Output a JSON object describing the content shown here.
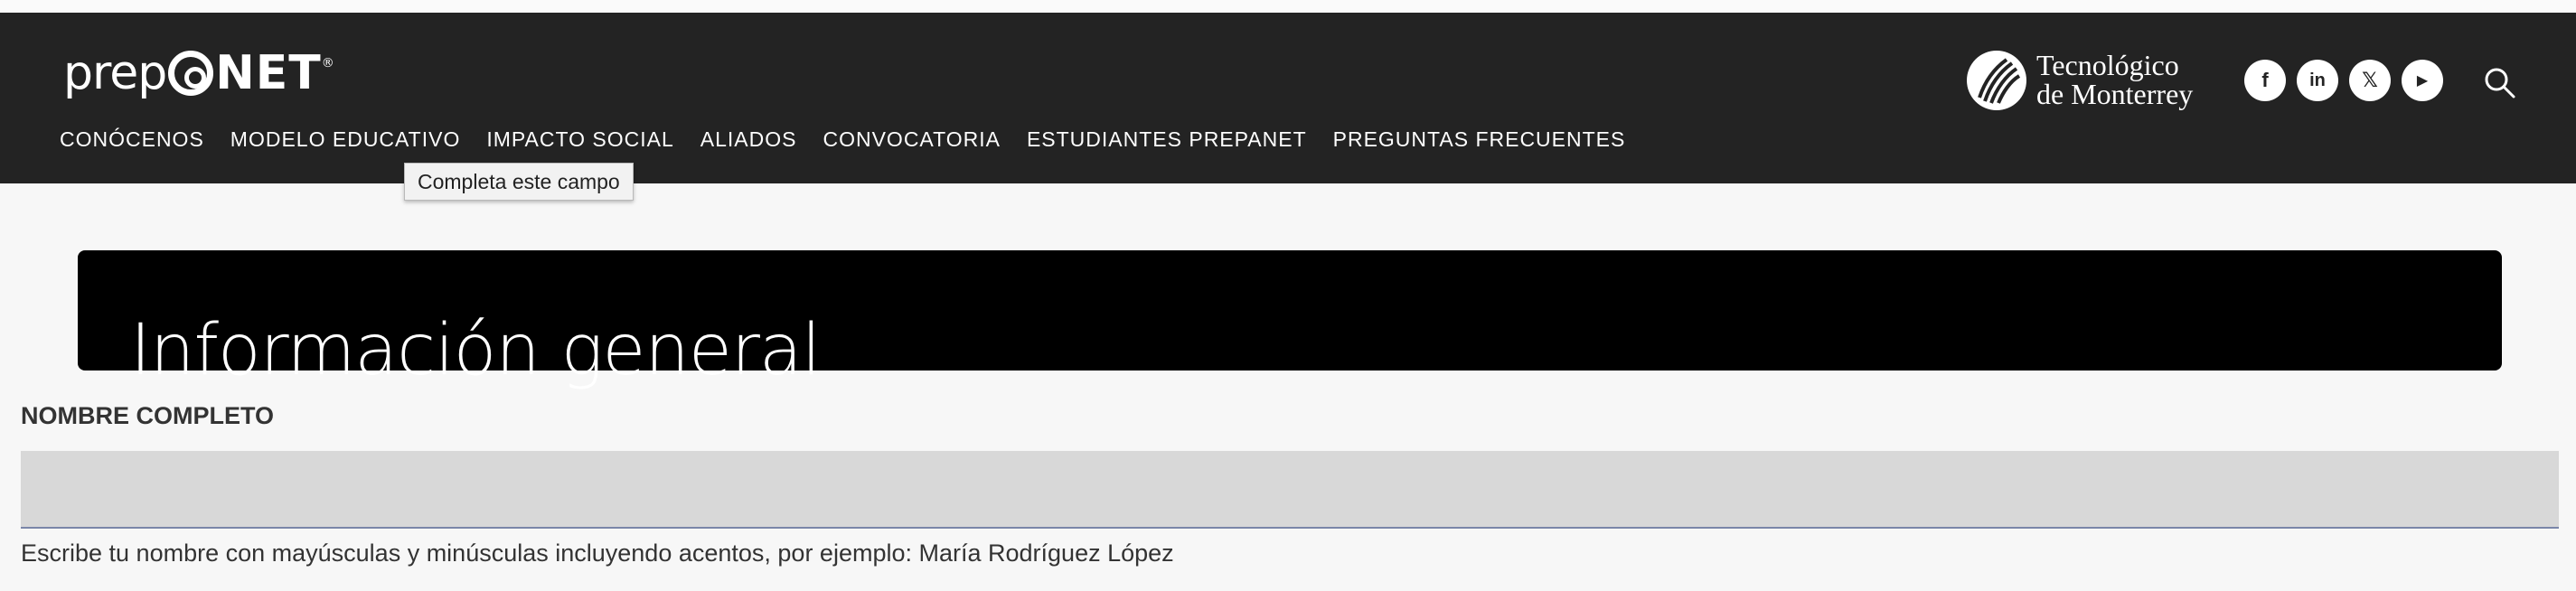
{
  "brand": {
    "logo_main": "prep",
    "logo_net": "NET",
    "logo_reg": "®",
    "tec_line1": "Tecnológico",
    "tec_line2": "de Monterrey"
  },
  "nav": {
    "items": [
      {
        "label": "CONÓCENOS"
      },
      {
        "label": "MODELO EDUCATIVO"
      },
      {
        "label": "IMPACTO SOCIAL"
      },
      {
        "label": "ALIADOS"
      },
      {
        "label": "CONVOCATORIA"
      },
      {
        "label": "ESTUDIANTES PREPANET"
      },
      {
        "label": "PREGUNTAS FRECUENTES"
      }
    ]
  },
  "tooltip": {
    "text": "Completa este campo"
  },
  "social": [
    {
      "icon": "facebook-icon",
      "glyph": "f"
    },
    {
      "icon": "linkedin-icon",
      "glyph": "in"
    },
    {
      "icon": "x-twitter-icon",
      "glyph": "𝕏"
    },
    {
      "icon": "youtube-icon",
      "glyph": "▶"
    }
  ],
  "banner": {
    "title": "Información general"
  },
  "form": {
    "full_name_label": "NOMBRE COMPLETO",
    "full_name_value": "",
    "full_name_help": "Escribe tu nombre con mayúsculas y minúsculas incluyendo acentos, por ejemplo: María Rodríguez López"
  },
  "colors": {
    "header_bg": "#232323",
    "banner_bg": "#000000",
    "input_bg": "#d8d8d8",
    "page_bg": "#f7f7f7"
  }
}
